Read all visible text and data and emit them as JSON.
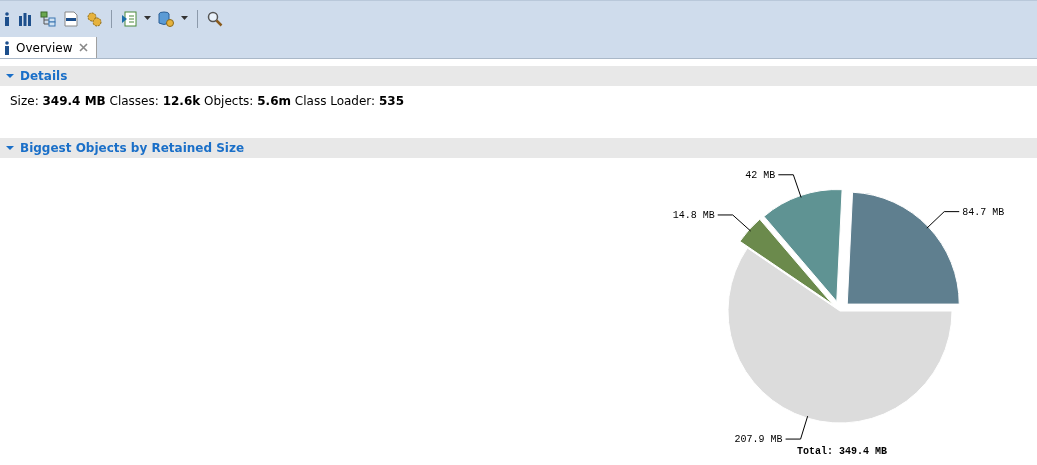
{
  "tabs": [
    {
      "label": "Overview",
      "selected": true
    }
  ],
  "sections": [
    {
      "title": "Details",
      "expanded": true,
      "text": "Size: **349.4 MB** Classes: **12.6k** Objects: **5.6m** Class Loader: **535**"
    },
    {
      "title": "Biggest Objects by Retained Size",
      "expanded": true,
      "chart_data": {
        "type": "pie",
        "values": [
          84.7,
          42,
          14.8,
          207.9
        ],
        "colors": [
          "#5f7f8f",
          "#5f9393",
          "#6b8a4c",
          "#dcdcdc"
        ],
        "value_labels": [
          "84.7 MB",
          "42 MB",
          "14.8 MB",
          "207.9 MB"
        ],
        "annotations": [
          "Total: 349.4 MB"
        ]
      }
    }
  ]
}
